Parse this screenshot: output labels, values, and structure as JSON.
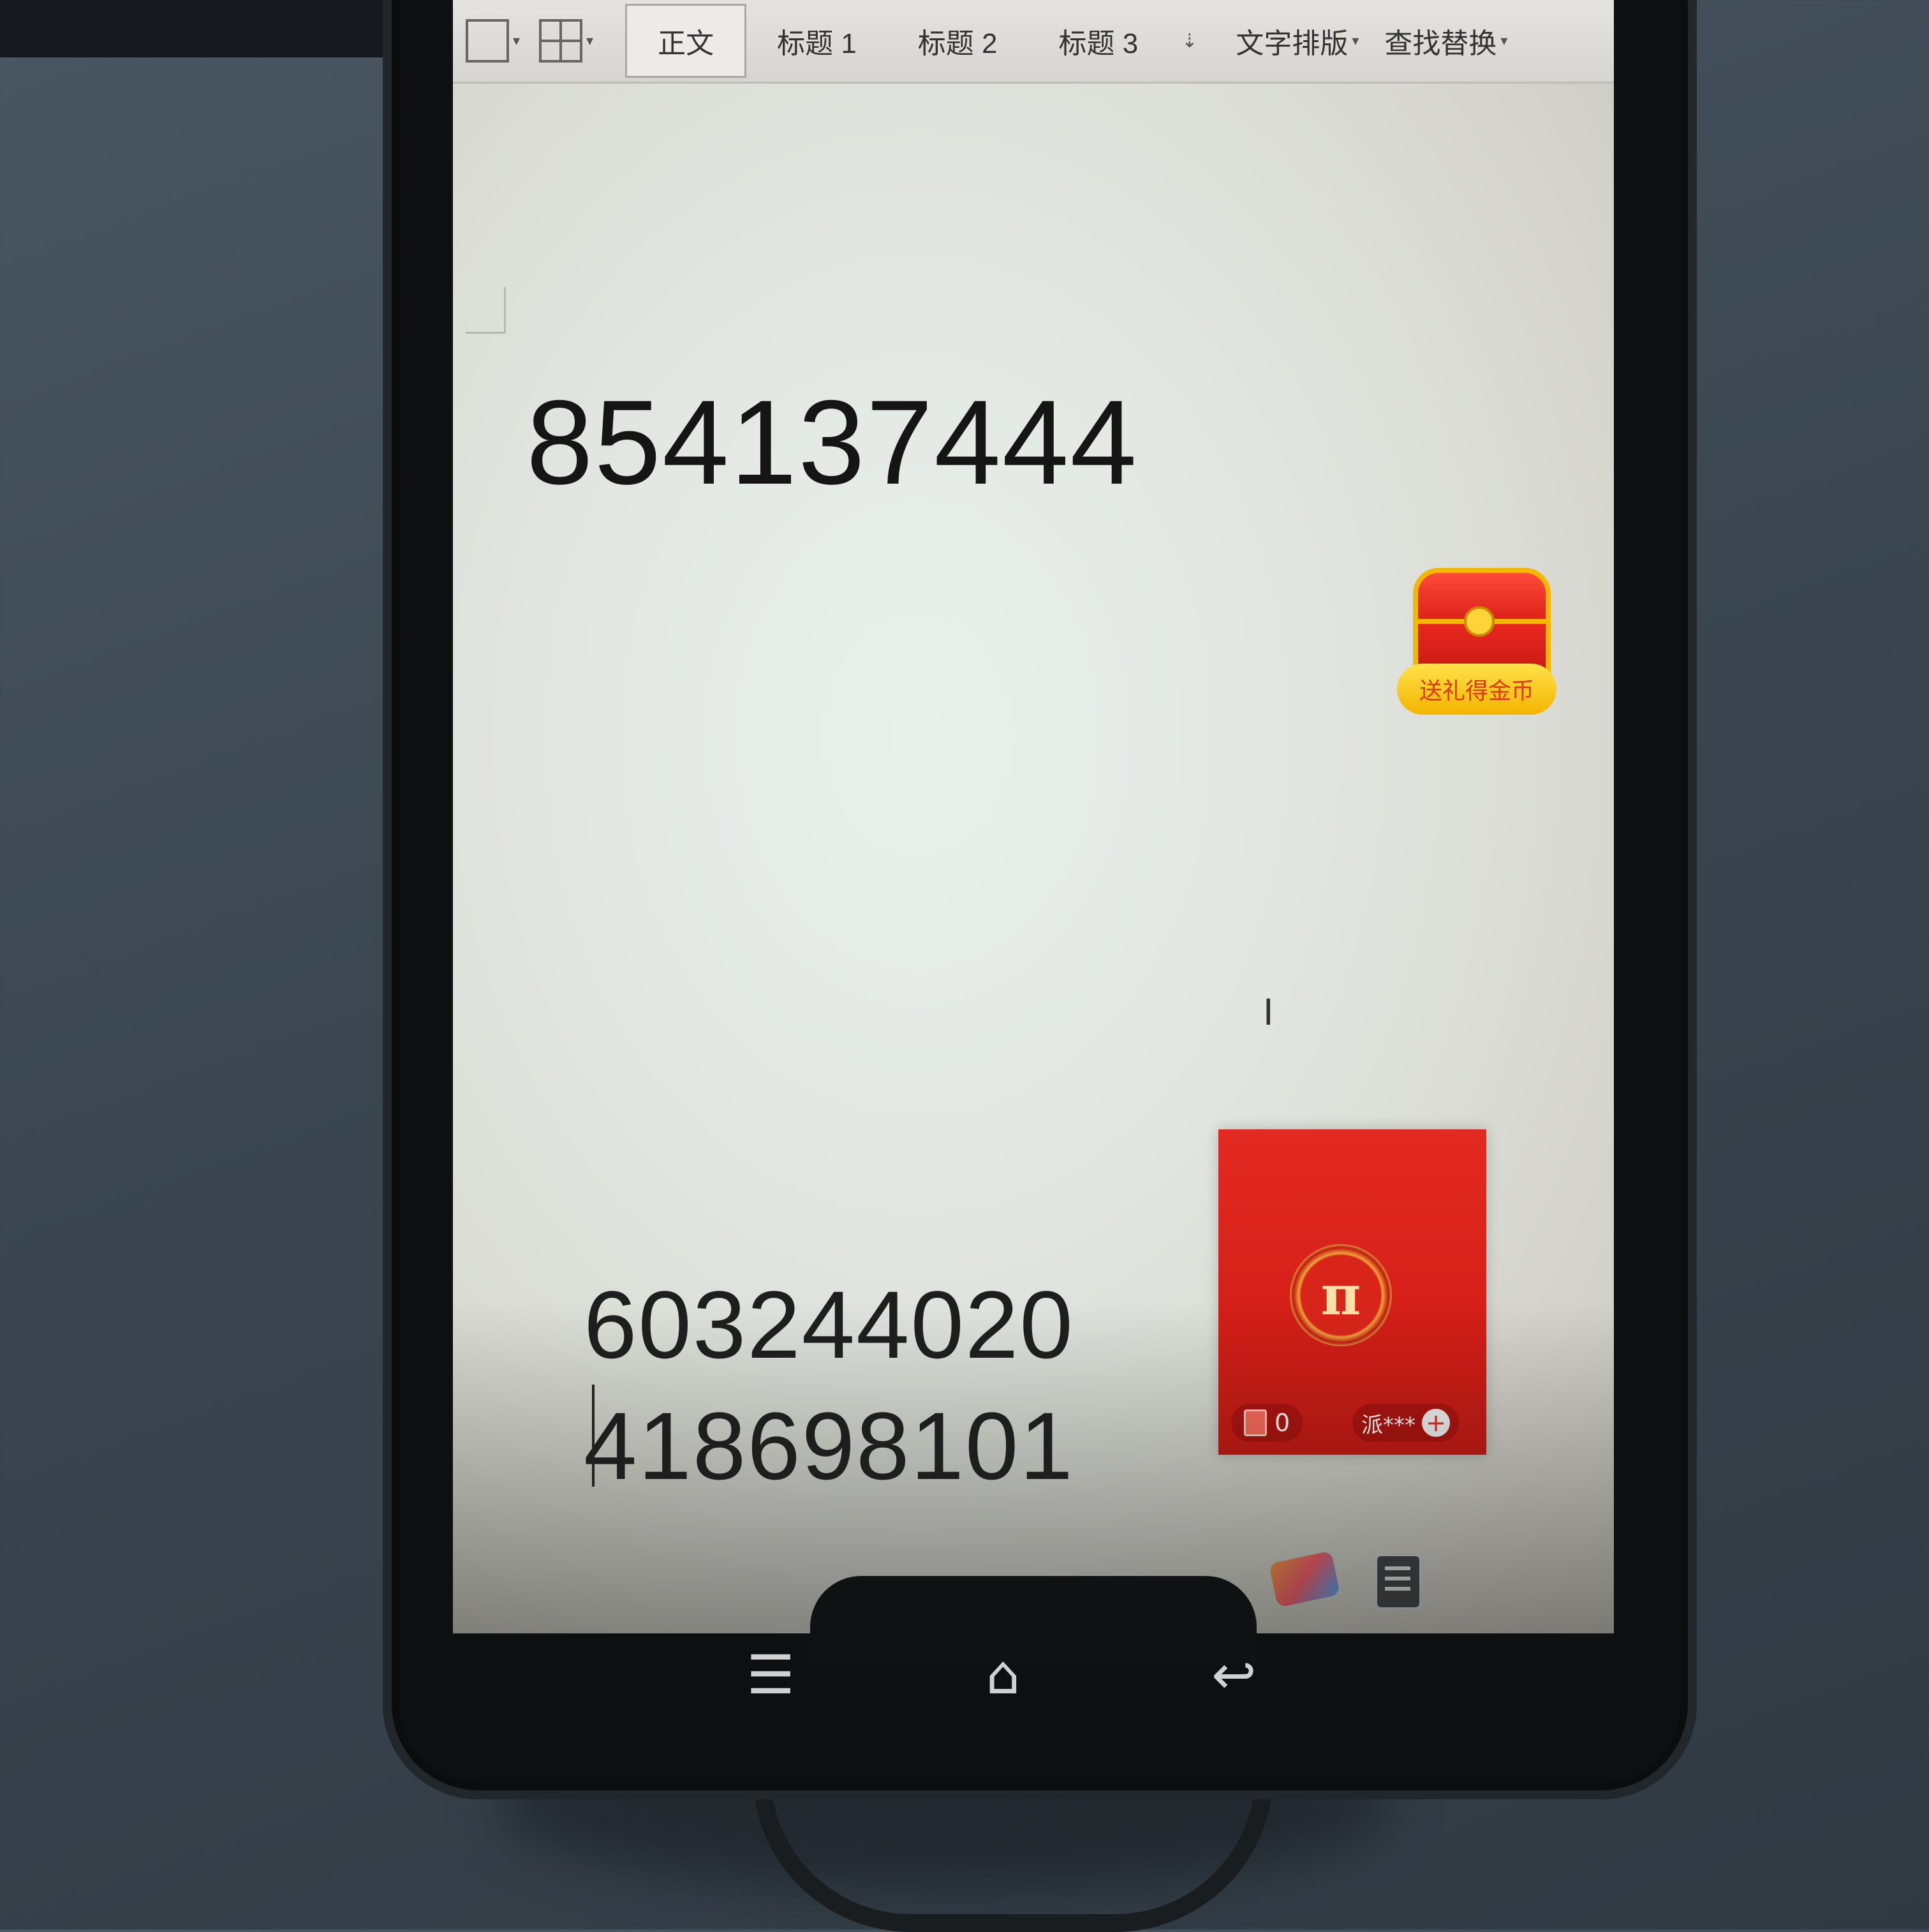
{
  "toolbar": {
    "styles": [
      "正文",
      "标题 1",
      "标题 2",
      "标题 3"
    ],
    "menu_items": [
      "文字排版",
      "查找替换"
    ]
  },
  "document": {
    "lines": [
      "854137444",
      "603244020",
      "418698101"
    ]
  },
  "overlay": {
    "chest_label": "送礼得金币",
    "live_card": {
      "gift_count": "0",
      "host_name": "派***",
      "coin_symbol": "π"
    }
  },
  "nav": {
    "menu_glyph": "☰",
    "home_glyph": "⌂",
    "back_glyph": "↩"
  },
  "colors": {
    "live_card_red": "#d71e18",
    "chest_gold": "#f5b800"
  }
}
